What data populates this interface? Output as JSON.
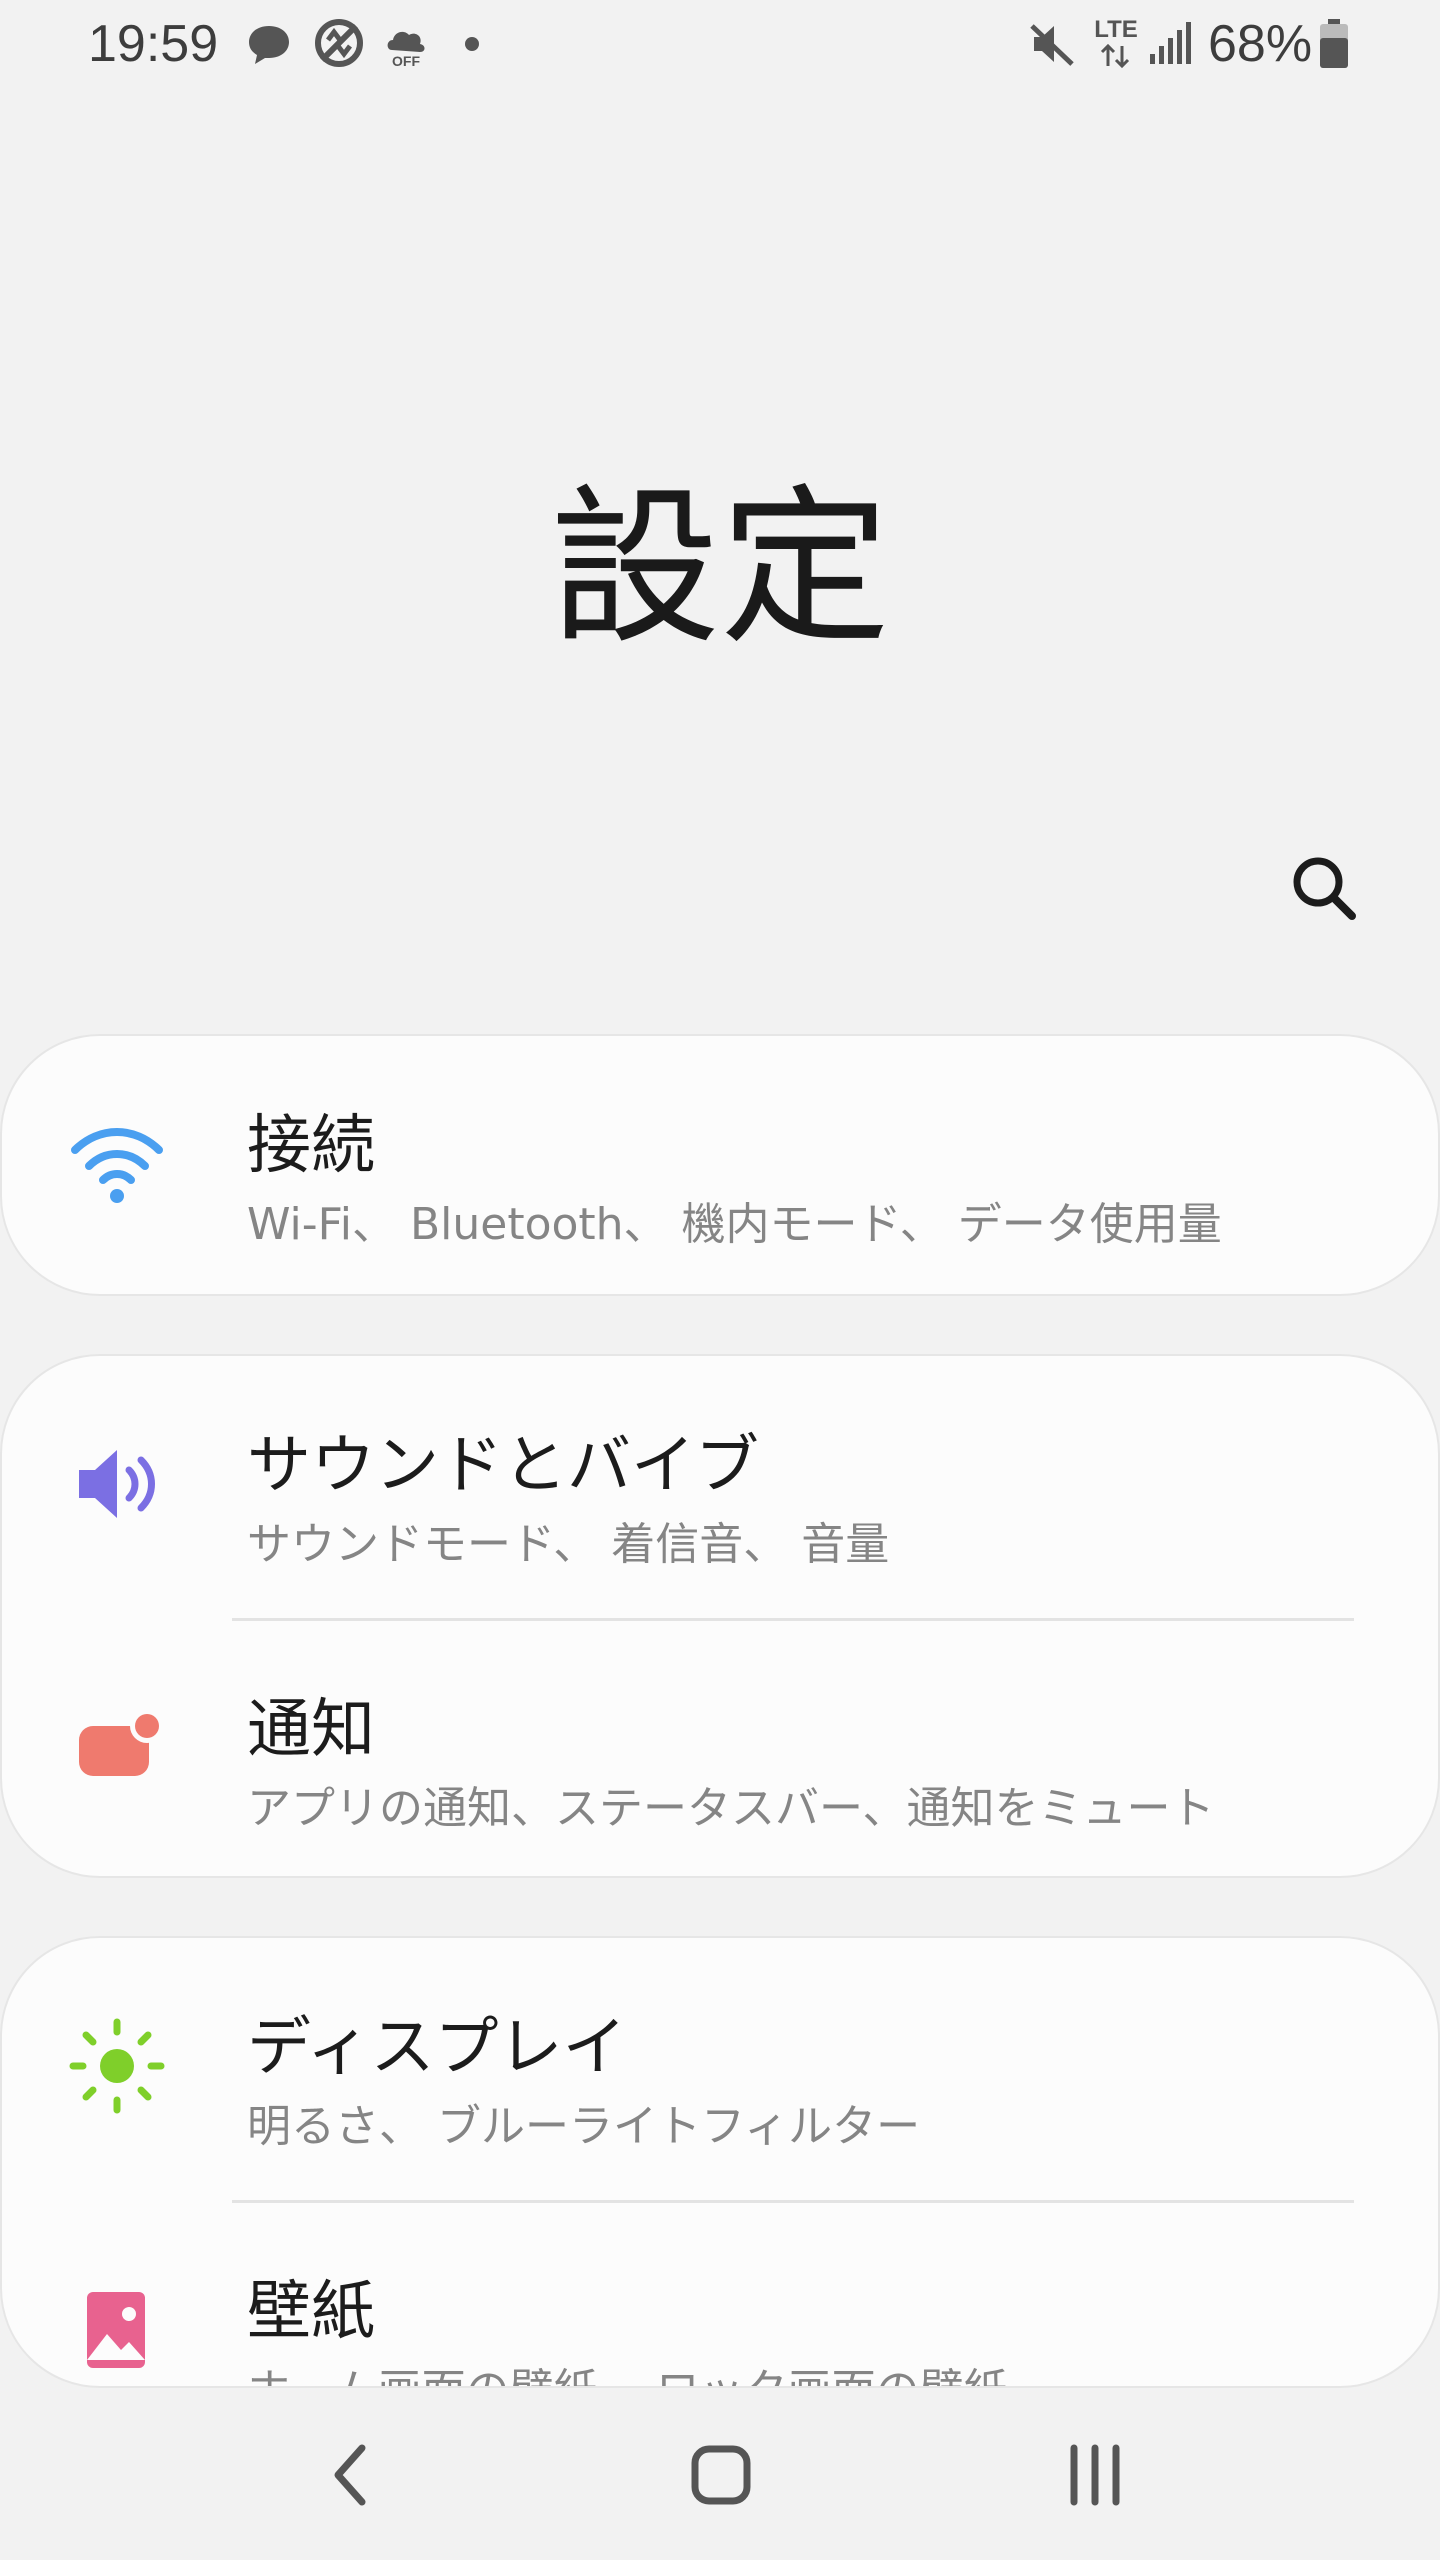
{
  "status_bar": {
    "time": "19:59",
    "network": "LTE",
    "battery": "68%",
    "icons": [
      "chat-bubble-icon",
      "no-sync-icon",
      "cloud-off-icon",
      "dot-icon",
      "mute-icon",
      "lte-icon",
      "signal-icon",
      "battery-icon"
    ],
    "cloud_badge": "OFF"
  },
  "header": {
    "title": "設定"
  },
  "settings": [
    {
      "title": "接続",
      "subtitle": "Wi-Fi、 Bluetooth、 機内モード、 データ使用量",
      "icon": "wifi-icon",
      "color": "#4a9ff0"
    },
    {
      "title": "サウンドとバイブ",
      "subtitle": "サウンドモード、 着信音、 音量",
      "icon": "sound-icon",
      "color": "#7b6fe3"
    },
    {
      "title": "通知",
      "subtitle": "アプリの通知、ステータスバー、通知をミュート",
      "icon": "notification-icon",
      "color": "#ef7a6e"
    },
    {
      "title": "ディスプレイ",
      "subtitle": "明るさ、 ブルーライトフィルター",
      "icon": "brightness-icon",
      "color": "#7fcf2a"
    },
    {
      "title": "壁紙",
      "subtitle": "ホーム画面の壁紙、 ロック画面の壁紙",
      "icon": "wallpaper-icon",
      "color": "#e8628f"
    }
  ],
  "nav": {
    "icons": [
      "back-icon",
      "home-icon",
      "recents-icon"
    ]
  }
}
